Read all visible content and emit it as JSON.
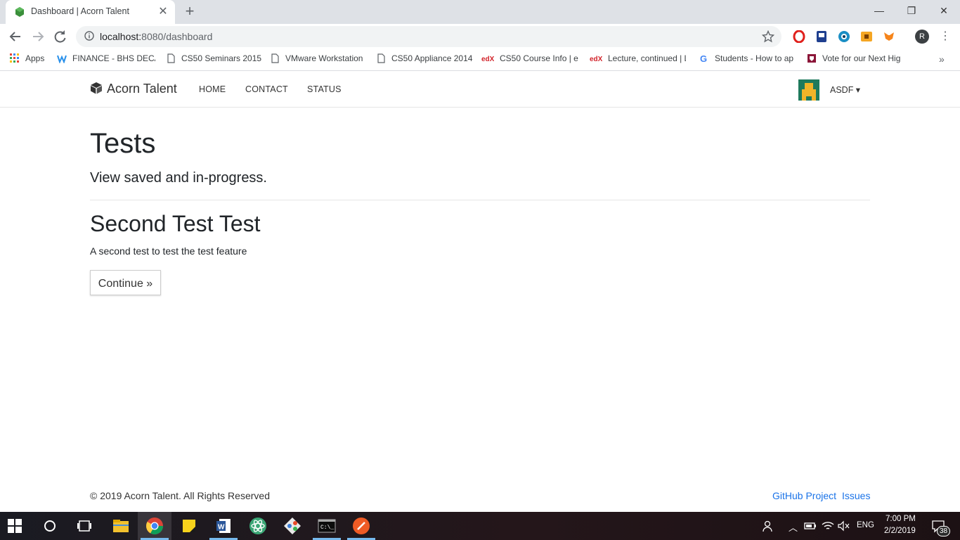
{
  "browser": {
    "tab_title": "Dashboard | Acorn Talent",
    "tab_close": "✕",
    "new_tab": "+",
    "url_host": "localhost:",
    "url_path": "8080/dashboard",
    "profile_initial": "R",
    "window_buttons": {
      "minimize": "—",
      "maximize": "❐",
      "close": "✕"
    }
  },
  "bookmarks": [
    {
      "label": "Apps",
      "icon": "apps-grid-icon"
    },
    {
      "label": "FINANCE - BHS DECA",
      "icon": "weebly-icon"
    },
    {
      "label": "CS50 Seminars 2015",
      "icon": "page-icon"
    },
    {
      "label": "VMware Workstation",
      "icon": "page-icon"
    },
    {
      "label": "CS50 Appliance 2014",
      "icon": "page-icon"
    },
    {
      "label": "CS50 Course Info | ec",
      "icon": "edx-icon"
    },
    {
      "label": "Lecture, continued | L",
      "icon": "edx-icon"
    },
    {
      "label": "Students - How to ap",
      "icon": "google-icon"
    },
    {
      "label": "Vote for our Next Hig",
      "icon": "shield-icon"
    }
  ],
  "bookmarks_more": "»",
  "site": {
    "brand": "Acorn Talent",
    "nav": {
      "home": "HOME",
      "contact": "CONTACT",
      "status": "STATUS"
    },
    "user": "ASDF ▾"
  },
  "main": {
    "title": "Tests",
    "subtitle": "View saved and in-progress.",
    "tests": [
      {
        "title": "Second Test Test",
        "description": "A second test to test the test feature",
        "button": "Continue »"
      }
    ]
  },
  "footer": {
    "copyright": "© 2019 Acorn Talent. All Rights Reserved",
    "links": {
      "github": "GitHub Project",
      "issues": "Issues"
    }
  },
  "taskbar": {
    "language": "ENG",
    "time": "7:00 PM",
    "date": "2/2/2019",
    "notifications": "38"
  },
  "colors": {
    "accent_link": "#1a73e8",
    "tabstrip": "#dee1e6",
    "taskbar": "#1a1b22"
  }
}
